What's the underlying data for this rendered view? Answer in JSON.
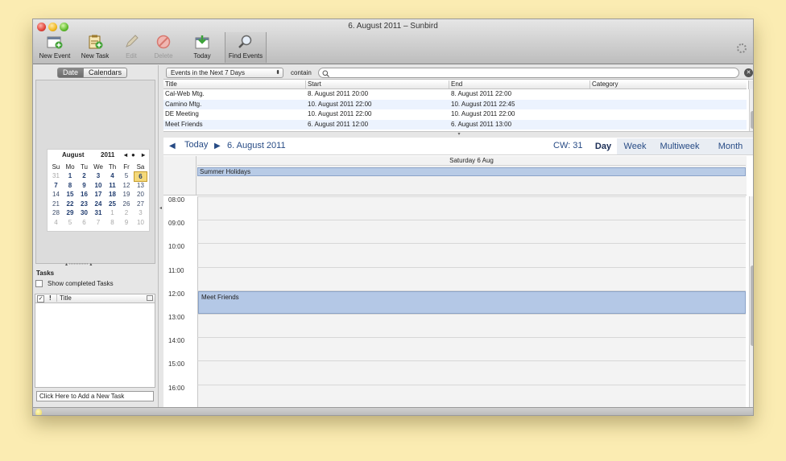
{
  "window": {
    "title": "6. August 2011 – Sunbird"
  },
  "toolbar": {
    "new_event": "New Event",
    "new_task": "New Task",
    "edit": "Edit",
    "delete": "Delete",
    "today": "Today",
    "find_events": "Find Events"
  },
  "sidebar": {
    "tab_date": "Date",
    "tab_calendars": "Calendars",
    "minical": {
      "month": "August",
      "year": "2011",
      "weekdays": [
        "Su",
        "Mo",
        "Tu",
        "We",
        "Th",
        "Fr",
        "Sa"
      ],
      "weeks": [
        [
          "31",
          "1",
          "2",
          "3",
          "4",
          "5",
          "6"
        ],
        [
          "7",
          "8",
          "9",
          "10",
          "11",
          "12",
          "13"
        ],
        [
          "14",
          "15",
          "16",
          "17",
          "18",
          "19",
          "20"
        ],
        [
          "21",
          "22",
          "23",
          "24",
          "25",
          "26",
          "27"
        ],
        [
          "28",
          "29",
          "30",
          "31",
          "1",
          "2",
          "3"
        ],
        [
          "4",
          "5",
          "6",
          "7",
          "8",
          "9",
          "10"
        ]
      ],
      "selected_day": "6"
    },
    "tasks_title": "Tasks",
    "show_completed": "Show completed Tasks",
    "task_col_check": "✓",
    "task_col_priority": "!",
    "task_col_title": "Title",
    "new_task_placeholder": "Click Here to Add a New Task"
  },
  "filter": {
    "range": "Events in the Next 7 Days",
    "contain_label": "contain",
    "search_value": ""
  },
  "events_table": {
    "columns": [
      "Title",
      "Start",
      "End",
      "Category"
    ],
    "rows": [
      {
        "title": "Cal-Web Mtg.",
        "start": "8. August 2011 20:00",
        "end": "8. August 2011 22:00",
        "category": ""
      },
      {
        "title": "Camino Mtg.",
        "start": "10. August 2011 22:00",
        "end": "10. August 2011 22:45",
        "category": ""
      },
      {
        "title": "DE Meeting",
        "start": "10. August 2011 22:00",
        "end": "10. August 2011 22:00",
        "category": ""
      },
      {
        "title": "Meet Friends",
        "start": "6. August 2011 12:00",
        "end": "6. August 2011 13:00",
        "category": ""
      }
    ]
  },
  "nav": {
    "prev": "◀",
    "today": "Today",
    "next": "▶",
    "date": "6. August 2011",
    "cw": "CW: 31",
    "views": [
      "Day",
      "Week",
      "Multiweek",
      "Month"
    ],
    "active_view": "Day"
  },
  "dayview": {
    "day_label": "Saturday 6 Aug",
    "allday_event": "Summer Holidays",
    "hours": [
      "08:00",
      "09:00",
      "10:00",
      "11:00",
      "12:00",
      "13:00",
      "14:00",
      "15:00",
      "16:00"
    ],
    "event": {
      "title": "Meet Friends",
      "start": "12:00",
      "end": "13:00"
    }
  },
  "colors": {
    "background": "#fbecb2",
    "event_fill": "#b4c8e6",
    "selected_day": "#f4d97a",
    "link_blue": "#274b85"
  }
}
